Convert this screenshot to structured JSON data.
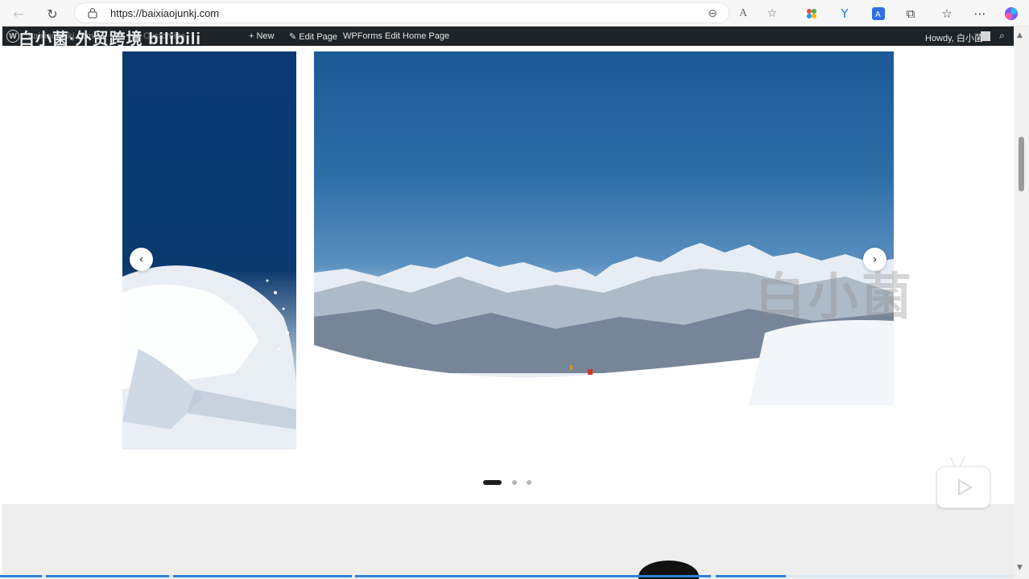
{
  "browser": {
    "url": "https://baixiaojunkj.com",
    "back_icon": "arrow-left-icon",
    "reload_icon": "reload-icon"
  },
  "adminbar": {
    "site_name": "baixiaojunkj.com",
    "watermark_text": "白小菌·外贸跨境 bilibili",
    "customize": "Customize",
    "new": "New",
    "edit_page": "Edit Page",
    "wpforms": "WPForms",
    "edit_home_page": "Edit Home Page",
    "howdy": "Howdy, 白小菌"
  },
  "slider": {
    "prev_symbol": "‹",
    "next_symbol": "›",
    "slide_count": 3,
    "active_index": 0
  },
  "overlay": {
    "watermark": "白小菌"
  },
  "colors": {
    "adminbar_bg": "#1d2327",
    "accent": "#2e82d6",
    "sky": "#1c5996"
  }
}
